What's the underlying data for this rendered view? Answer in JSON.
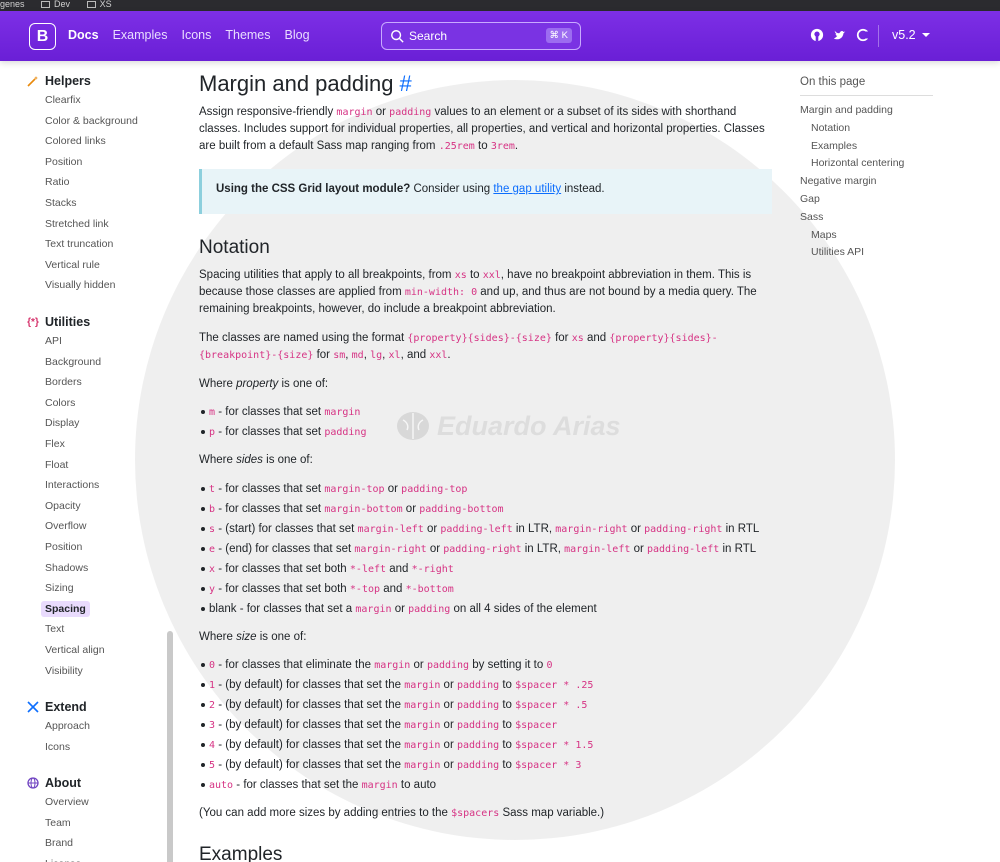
{
  "os_bar": {
    "items": [
      "genes",
      "Dev",
      "XS"
    ]
  },
  "navbar": {
    "brand": "B",
    "links": [
      "Docs",
      "Examples",
      "Icons",
      "Themes",
      "Blog"
    ],
    "search_placeholder": "Search",
    "search_shortcut": "⌘ K",
    "version": "v5.2",
    "accent": "#712cf9"
  },
  "sidebar": {
    "helpers": {
      "title": "Helpers",
      "items": [
        "Clearfix",
        "Color & background",
        "Colored links",
        "Position",
        "Ratio",
        "Stacks",
        "Stretched link",
        "Text truncation",
        "Vertical rule",
        "Visually hidden"
      ]
    },
    "utilities": {
      "title": "Utilities",
      "items": [
        "API",
        "Background",
        "Borders",
        "Colors",
        "Display",
        "Flex",
        "Float",
        "Interactions",
        "Opacity",
        "Overflow",
        "Position",
        "Shadows",
        "Sizing",
        "Spacing",
        "Text",
        "Vertical align",
        "Visibility"
      ],
      "active": "Spacing"
    },
    "extend": {
      "title": "Extend",
      "items": [
        "Approach",
        "Icons"
      ]
    },
    "about": {
      "title": "About",
      "items": [
        "Overview",
        "Team",
        "Brand",
        "License"
      ]
    }
  },
  "main": {
    "h1": "Margin and padding",
    "h1_anchor": "#",
    "intro": {
      "t1": "Assign responsive-friendly ",
      "c1": "margin",
      "t2": " or ",
      "c2": "padding",
      "t3": " values to an element or a subset of its sides with shorthand classes. Includes support for individual properties, all properties, and vertical and horizontal properties. Classes are built from a default Sass map ranging from ",
      "c3": ".25rem",
      "t4": " to ",
      "c4": "3rem",
      "t5": "."
    },
    "callout": {
      "bold": "Using the CSS Grid layout module?",
      "t1": " Consider using ",
      "link": "the gap utility",
      "t2": " instead."
    },
    "notation_h2": "Notation",
    "notation_p1": {
      "t1": "Spacing utilities that apply to all breakpoints, from ",
      "c1": "xs",
      "t2": " to ",
      "c2": "xxl",
      "t3": ", have no breakpoint abbreviation in them. This is because those classes are applied from ",
      "c3": "min-width: 0",
      "t4": " and up, and thus are not bound by a media query. The remaining breakpoints, however, do include a breakpoint abbreviation."
    },
    "notation_p2": {
      "t1": "The classes are named using the format ",
      "c1": "{property}{sides}-{size}",
      "t2": " for ",
      "c2": "xs",
      "t3": " and ",
      "c3": "{property}{sides}-{breakpoint}-{size}",
      "t4": " for ",
      "c4": "sm",
      "t5": ", ",
      "c5": "md",
      "t6": ", ",
      "c6": "lg",
      "t7": ", ",
      "c7": "xl",
      "t8": ", and ",
      "c8": "xxl",
      "t9": "."
    },
    "property_intro": {
      "t1": "Where ",
      "em": "property",
      "t2": " is one of:"
    },
    "property_items": [
      {
        "code": "m",
        "t1": " - for classes that set ",
        "c2": "margin"
      },
      {
        "code": "p",
        "t1": " - for classes that set ",
        "c2": "padding"
      }
    ],
    "sides_intro": {
      "t1": "Where ",
      "em": "sides",
      "t2": " is one of:"
    },
    "sides_items": [
      {
        "c1": "t",
        "t1": " - for classes that set ",
        "c2": "margin-top",
        "t2": " or ",
        "c3": "padding-top"
      },
      {
        "c1": "b",
        "t1": " - for classes that set ",
        "c2": "margin-bottom",
        "t2": " or ",
        "c3": "padding-bottom"
      },
      {
        "c1": "s",
        "t1": " - (start) for classes that set ",
        "c2": "margin-left",
        "t2": " or ",
        "c3": "padding-left",
        "t3": " in LTR, ",
        "c4": "margin-right",
        "t4": " or ",
        "c5": "padding-right",
        "t5": " in RTL"
      },
      {
        "c1": "e",
        "t1": " - (end) for classes that set ",
        "c2": "margin-right",
        "t2": " or ",
        "c3": "padding-right",
        "t3": " in LTR, ",
        "c4": "margin-left",
        "t4": " or ",
        "c5": "padding-left",
        "t5": " in RTL"
      },
      {
        "c1": "x",
        "t1": " - for classes that set both ",
        "c2": "*-left",
        "t2": " and ",
        "c3": "*-right"
      },
      {
        "c1": "y",
        "t1": " - for classes that set both ",
        "c2": "*-top",
        "t2": " and ",
        "c3": "*-bottom"
      },
      {
        "t0": "blank",
        "t1": " - for classes that set a ",
        "c2": "margin",
        "t2": " or ",
        "c3": "padding",
        "t3": " on all 4 sides of the element"
      }
    ],
    "size_intro": {
      "t1": "Where ",
      "em": "size",
      "t2": " is one of:"
    },
    "size_items": [
      {
        "c1": "0",
        "t1": " - for classes that eliminate the ",
        "c2": "margin",
        "t2": " or ",
        "c3": "padding",
        "t3": " by setting it to ",
        "c4": "0"
      },
      {
        "c1": "1",
        "t1": " - (by default) for classes that set the ",
        "c2": "margin",
        "t2": " or ",
        "c3": "padding",
        "t3": " to ",
        "c4": "$spacer * .25"
      },
      {
        "c1": "2",
        "t1": " - (by default) for classes that set the ",
        "c2": "margin",
        "t2": " or ",
        "c3": "padding",
        "t3": " to ",
        "c4": "$spacer * .5"
      },
      {
        "c1": "3",
        "t1": " - (by default) for classes that set the ",
        "c2": "margin",
        "t2": " or ",
        "c3": "padding",
        "t3": " to ",
        "c4": "$spacer"
      },
      {
        "c1": "4",
        "t1": " - (by default) for classes that set the ",
        "c2": "margin",
        "t2": " or ",
        "c3": "padding",
        "t3": " to ",
        "c4": "$spacer * 1.5"
      },
      {
        "c1": "5",
        "t1": " - (by default) for classes that set the ",
        "c2": "margin",
        "t2": " or ",
        "c3": "padding",
        "t3": " to ",
        "c4": "$spacer * 3"
      },
      {
        "c1": "auto",
        "t1": " - for classes that set the ",
        "c2": "margin",
        "t2": " to auto"
      }
    ],
    "sizes_note": {
      "t1": "(You can add more sizes by adding entries to the ",
      "c1": "$spacers",
      "t2": " Sass map variable.)"
    },
    "examples_h2": "Examples"
  },
  "watermark": "Eduardo Arias",
  "toc": {
    "title": "On this page",
    "items": [
      {
        "label": "Margin and padding",
        "sub": false
      },
      {
        "label": "Notation",
        "sub": true
      },
      {
        "label": "Examples",
        "sub": true
      },
      {
        "label": "Horizontal centering",
        "sub": true
      },
      {
        "label": "Negative margin",
        "sub": false
      },
      {
        "label": "Gap",
        "sub": false
      },
      {
        "label": "Sass",
        "sub": false
      },
      {
        "label": "Maps",
        "sub": true
      },
      {
        "label": "Utilities API",
        "sub": true
      }
    ]
  }
}
